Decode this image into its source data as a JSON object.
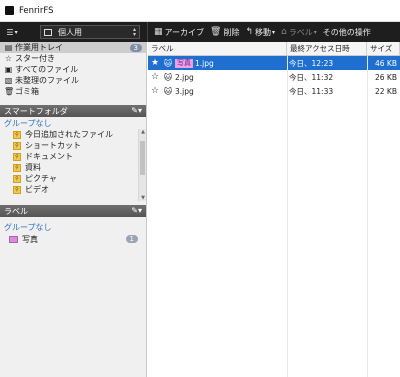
{
  "window": {
    "title": "FenrirFS"
  },
  "toolbar": {
    "profile": "個人用",
    "archive": "アーカイブ",
    "delete": "削除",
    "move": "移動",
    "label": "ラベル",
    "other": "その他の操作"
  },
  "library": [
    {
      "label": "作業用トレイ",
      "icon": "tray-icon",
      "glyph": "▤",
      "count": "3",
      "selected": true
    },
    {
      "label": "スター付き",
      "icon": "star-icon",
      "glyph": "☆"
    },
    {
      "label": "すべてのファイル",
      "icon": "all-files-icon",
      "glyph": "▣"
    },
    {
      "label": "未整理のファイル",
      "icon": "unsorted-files-icon",
      "glyph": "▧"
    },
    {
      "label": "ゴミ箱",
      "icon": "trash-icon",
      "glyph": "🗑"
    }
  ],
  "smart_folders": {
    "title": "スマートフォルダ",
    "group": "グループなし",
    "items": [
      "今日追加されたファイル",
      "ショートカット",
      "ドキュメント",
      "資料",
      "ピクチャ",
      "ビデオ"
    ]
  },
  "labels": {
    "title": "ラベル",
    "group": "グループなし",
    "items": [
      {
        "name": "写真",
        "count": "1",
        "color": "#d98cd9"
      }
    ]
  },
  "columns": {
    "name": "ラベル",
    "accessed": "最終アクセス日時",
    "size": "サイズ"
  },
  "files": [
    {
      "tag": "写真",
      "name": "1.jpg",
      "accessed": "今日、12:23",
      "size": "46 KB",
      "starred": true,
      "selected": true
    },
    {
      "tag": "",
      "name": "2.jpg",
      "accessed": "今日、11:32",
      "size": "26 KB",
      "starred": false,
      "selected": false
    },
    {
      "tag": "",
      "name": "3.jpg",
      "accessed": "今日、11:33",
      "size": "22 KB",
      "starred": false,
      "selected": false
    }
  ],
  "colors": {
    "accent": "#1f6fd1",
    "label_photo": "#e8a3e8",
    "group_text": "#2c6fbf"
  }
}
